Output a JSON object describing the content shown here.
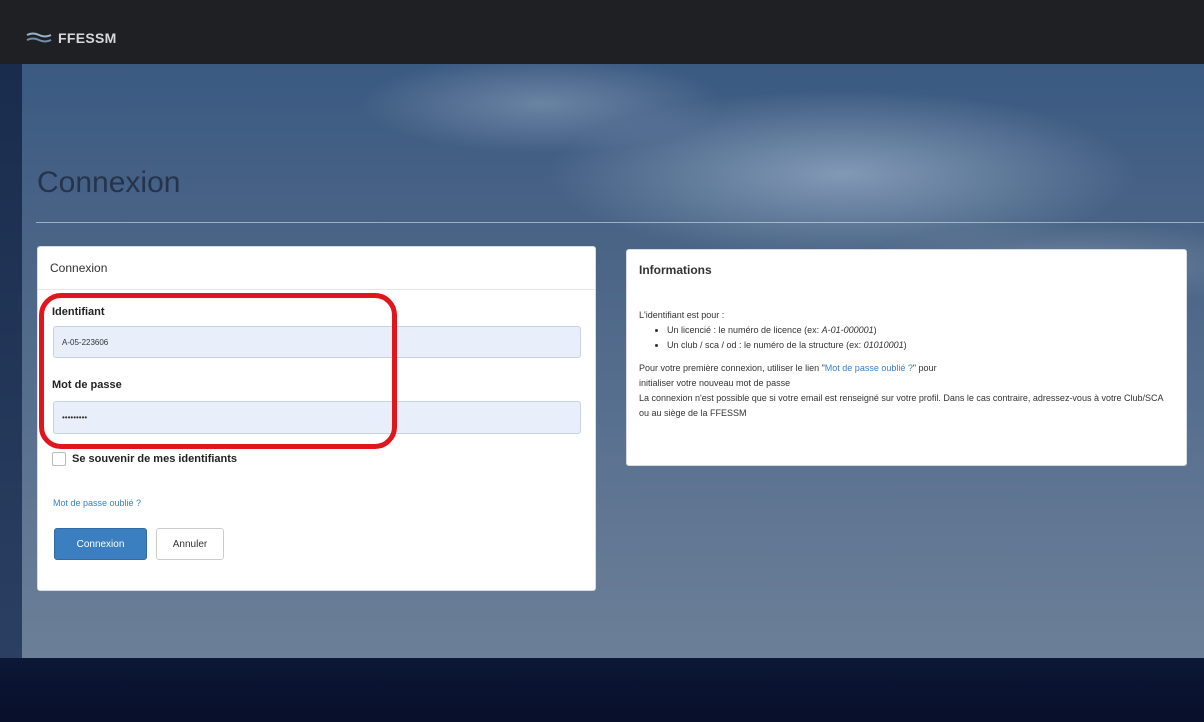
{
  "brand": {
    "name": "FFESSM"
  },
  "page": {
    "title": "Connexion"
  },
  "login_panel": {
    "heading": "Connexion",
    "identifier_label": "Identifiant",
    "identifier_value": "A-05-223606",
    "password_label": "Mot de passe",
    "password_value": "•••••••••",
    "remember_label": "Se souvenir de mes identifiants",
    "forgot_link": "Mot de passe oublié ?",
    "submit_label": "Connexion",
    "cancel_label": "Annuler"
  },
  "info_panel": {
    "heading": "Informations",
    "intro": "L'identifiant est pour :",
    "bullets": [
      {
        "text": "Un licencié : le numéro de licence (ex: ",
        "example": "A-01-000001",
        "close": ")"
      },
      {
        "text": "Un club / sca / od : le numéro de la structure (ex: ",
        "example": "01010001",
        "close": ")"
      }
    ],
    "first_login_pre": "Pour votre première connexion, utiliser le lien \"",
    "first_login_link": "Mot de passe oublié ?",
    "first_login_post": "\" pour",
    "first_login_line2": "initialiser votre nouveau mot de passe",
    "email_note": "La connexion n'est possible que si votre email est renseigné sur votre profil. Dans le cas contraire, adressez-vous à votre Club/SCA ou au siège de la FFESSM"
  },
  "colors": {
    "primary": "#3b7fc0",
    "link": "#3a82c4",
    "highlight": "#e1161c",
    "topbar": "#1f2024"
  }
}
